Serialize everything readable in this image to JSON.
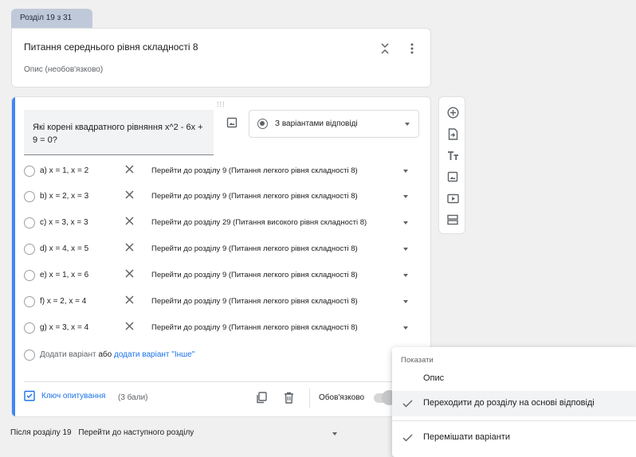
{
  "section_tab": "Розділ 19 з 31",
  "title_card": {
    "title": "Питання середнього рівня складності 8",
    "description": "Опис (необов'язково)",
    "collapse_icon": "collapse-icon",
    "more_icon": "more-vert-icon"
  },
  "question": {
    "text": "Які корені квадратного рівняння x^2 - 6x + 9 = 0?",
    "type_label": "З варіантами відповіді",
    "options": [
      {
        "label": "a) x = 1, x = 2",
        "goto": "Перейти до розділу 9 (Питання легкого рівня складності 8)"
      },
      {
        "label": "b) x = 2, x = 3",
        "goto": "Перейти до розділу 9 (Питання легкого рівня складності 8)"
      },
      {
        "label": "c) x = 3, x = 3",
        "goto": "Перейти до розділу 29 (Питання високого рівня складності 8)"
      },
      {
        "label": "d) x = 4, x = 5",
        "goto": "Перейти до розділу 9 (Питання легкого рівня складності 8)"
      },
      {
        "label": "e) x = 1, x = 6",
        "goto": "Перейти до розділу 9 (Питання легкого рівня складності 8)"
      },
      {
        "label": "f) x = 2, x = 4",
        "goto": "Перейти до розділу 9 (Питання легкого рівня складності 8)"
      },
      {
        "label": "g) x = 3, x = 4",
        "goto": "Перейти до розділу 9 (Питання легкого рівня складності 8)"
      }
    ],
    "add_option": "Додати варіант",
    "or": "або",
    "add_other": "додати варіант \"Інше\"",
    "answer_key": "Ключ опитування",
    "points": "(3 бали)",
    "required": "Обов'язково"
  },
  "after_section": {
    "label": "Після розділу 19",
    "value": "Перейти до наступного розділу"
  },
  "menu": {
    "header": "Показати",
    "items": [
      {
        "label": "Опис",
        "checked": false
      },
      {
        "label": "Переходити до розділу на основі відповіді",
        "checked": true
      },
      {
        "label": "Перемішати варіанти",
        "checked": true
      }
    ]
  },
  "toolbar": [
    "add-question-icon",
    "import-question-icon",
    "add-title-icon",
    "add-image-icon",
    "add-video-icon",
    "add-section-icon"
  ],
  "colors": {
    "accent": "#4285f4",
    "link": "#1a73e8",
    "tab": "#bfc9d9"
  }
}
